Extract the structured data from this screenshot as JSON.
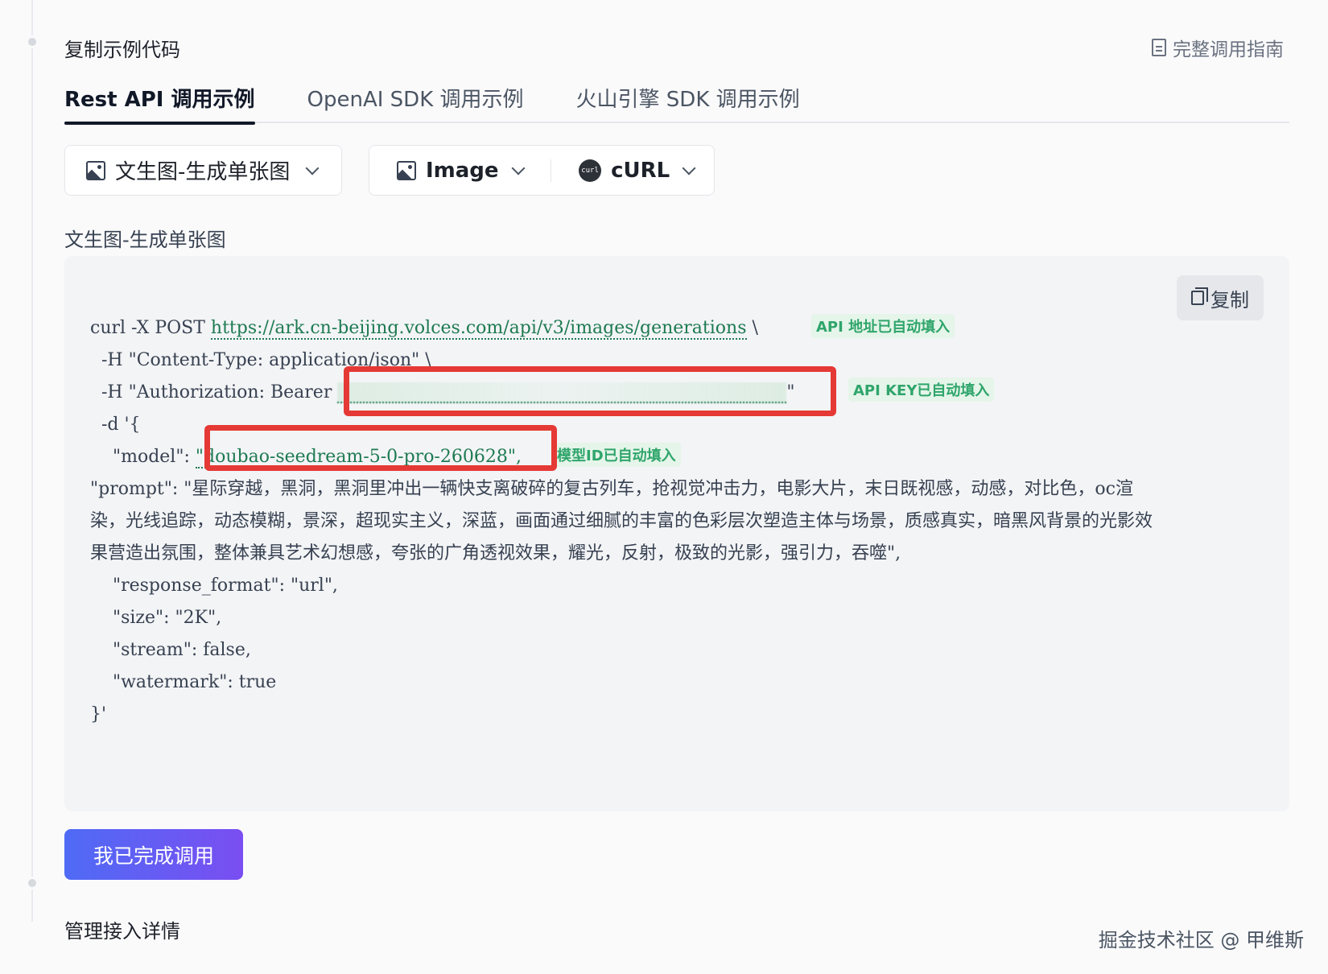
{
  "step1": {
    "title": "复制示例代码"
  },
  "guide_link": {
    "label": "完整调用指南",
    "icon": "document-icon"
  },
  "tabs": [
    {
      "label": "Rest API 调用示例",
      "active": true
    },
    {
      "label": "OpenAI SDK 调用示例",
      "active": false
    },
    {
      "label": "火山引擎 SDK 调用示例",
      "active": false
    }
  ],
  "selectors": {
    "scenario": "文生图-生成单张图",
    "output_type": "Image",
    "language": "cURL",
    "curl_icon_text": "curl"
  },
  "section_label": "文生图-生成单张图",
  "copy_button": "复制",
  "code": {
    "line1_prefix": "curl -X POST ",
    "url": "https://ark.cn-beijing.volces.com/api/v3/images/generations",
    "line1_suffix": " \\",
    "line2": "  -H \"Content-Type: application/json\" \\",
    "line3_prefix": "  -H \"Authorization: Bearer ",
    "line3_suffix": "\"",
    "line4": "  -d '{",
    "line5_prefix": "    \"model\": ",
    "model_value": "\"doubao-seedream-5-0-pro-260628\",",
    "prompt": "    \"prompt\": \"星际穿越，黑洞，黑洞里冲出一辆快支离破碎的复古列车，抢视觉冲击力，电影大片，末日既视感，动感，对比色，oc渲染，光线追踪，动态模糊，景深，超现实主义，深蓝，画面通过细腻的丰富的色彩层次塑造主体与场景，质感真实，暗黑风背景的光影效果营造出氛围，整体兼具艺术幻想感，夸张的广角透视效果，耀光，反射，极致的光影，强引力，吞噬\",",
    "line_response_format": "    \"response_format\": \"url\",",
    "line_size": "    \"size\": \"2K\",",
    "line_stream": "    \"stream\": false,",
    "line_watermark": "    \"watermark\": true",
    "line_end": "}'"
  },
  "annotations": {
    "api_url": "API 地址已自动填入",
    "api_key": "API KEY已自动填入",
    "model_id": "模型ID已自动填入"
  },
  "done_button": "我已完成调用",
  "step2": {
    "title": "管理接入详情"
  },
  "watermark": "掘金技术社区 @ 甲维斯",
  "colors": {
    "annotation_green": "#2fa56b",
    "highlight_red": "#e53935",
    "button_gradient_start": "#4f6bf5",
    "button_gradient_end": "#7a4ef2"
  }
}
